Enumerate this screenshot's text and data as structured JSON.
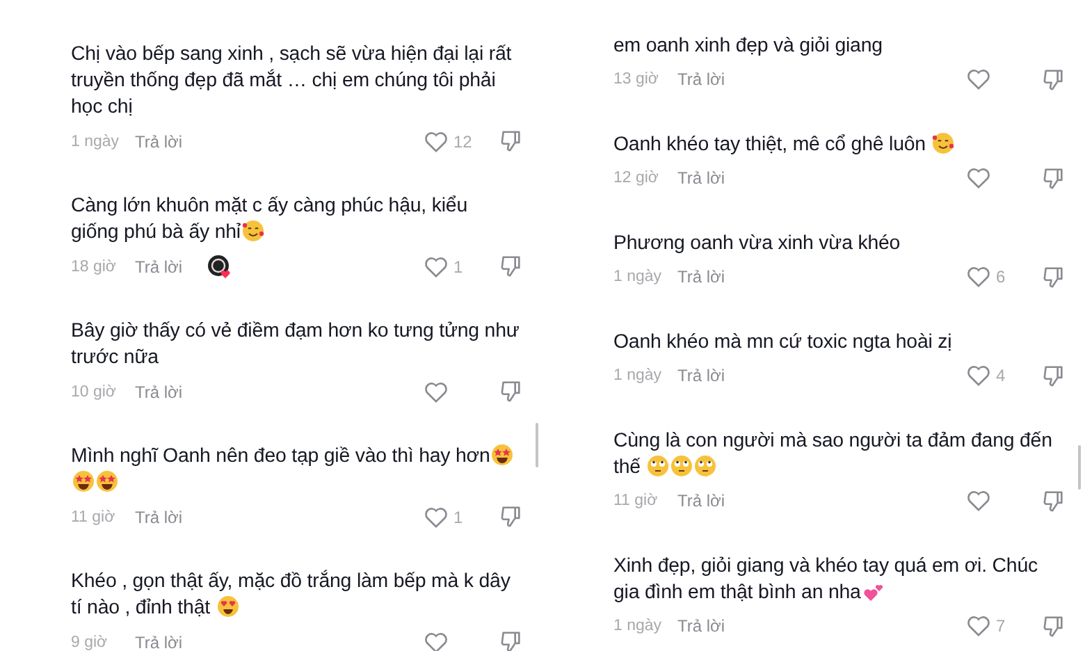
{
  "panels": [
    {
      "comments": [
        {
          "lines": [
            "Chị vào bếp sang xinh , sạch sẽ vừa hiện đại lại rất",
            "truyền thống đẹp đã mắt … chị em chúng tôi phải",
            "học chị"
          ],
          "time": "1 ngày",
          "reply": "Trả lời",
          "creator_liked": false,
          "likes": "12"
        },
        {
          "lines": [
            "Càng lớn khuôn mặt c ấy càng phúc hậu, kiểu",
            "giống phú bà ấy nhỉ"
          ],
          "emojis": [
            {
              "kind": "hearts-face"
            }
          ],
          "time": "18 giờ",
          "reply": "Trả lời",
          "creator_liked": true,
          "likes": "1"
        },
        {
          "lines": [
            "Bây giờ thấy có vẻ điềm đạm hơn ko tưng tửng như",
            "trước nữa"
          ],
          "time": "10 giờ",
          "reply": "Trả lời",
          "creator_liked": false
        },
        {
          "lines": [
            "Mình nghĩ Oanh nên đeo tạp giề vào thì hay hơn"
          ],
          "emojis": [
            {
              "kind": "star-eyes"
            },
            {
              "kind": "star-eyes"
            },
            {
              "kind": "star-eyes"
            }
          ],
          "time": "11 giờ",
          "reply": "Trả lời",
          "creator_liked": false,
          "likes": "1"
        },
        {
          "lines": [
            "Khéo , gọn thật ấy, mặc đồ trắng làm bếp mà k dây",
            "tí nào , đỉnh thật "
          ],
          "emojis": [
            {
              "kind": "heart-eyes"
            }
          ],
          "time": "9 giờ",
          "reply": "Trả lời",
          "creator_liked": false
        }
      ]
    },
    {
      "comments": [
        {
          "lines": [
            "em oanh xinh đẹp và giỏi giang"
          ],
          "time": "13 giờ",
          "reply": "Trả lời",
          "creator_liked": false
        },
        {
          "lines": [
            "Oanh khéo tay thiệt, mê cổ ghê luôn "
          ],
          "emojis": [
            {
              "kind": "hearts-face"
            }
          ],
          "time": "12 giờ",
          "reply": "Trả lời",
          "creator_liked": false
        },
        {
          "lines": [
            "Phương oanh vừa xinh vừa khéo"
          ],
          "time": "1 ngày",
          "reply": "Trả lời",
          "creator_liked": false,
          "likes": "6"
        },
        {
          "lines": [
            "Oanh khéo mà mn cứ toxic ngta hoài zị"
          ],
          "time": "1 ngày",
          "reply": "Trả lời",
          "creator_liked": false,
          "likes": "4"
        },
        {
          "lines": [
            "Cùng là con người mà sao người ta đảm đang đến",
            "thế "
          ],
          "emojis": [
            {
              "kind": "eye-roll"
            },
            {
              "kind": "eye-roll"
            },
            {
              "kind": "eye-roll"
            }
          ],
          "time": "11 giờ",
          "reply": "Trả lời",
          "creator_liked": false
        },
        {
          "lines": [
            "Xinh đẹp, giỏi giang và khéo tay quá em ơi. Chúc",
            "gia đình em thật bình an nha"
          ],
          "emojis": [
            {
              "kind": "two-hearts"
            }
          ],
          "time": "1 ngày",
          "reply": "Trả lời",
          "creator_liked": false,
          "likes": "7"
        }
      ]
    }
  ]
}
